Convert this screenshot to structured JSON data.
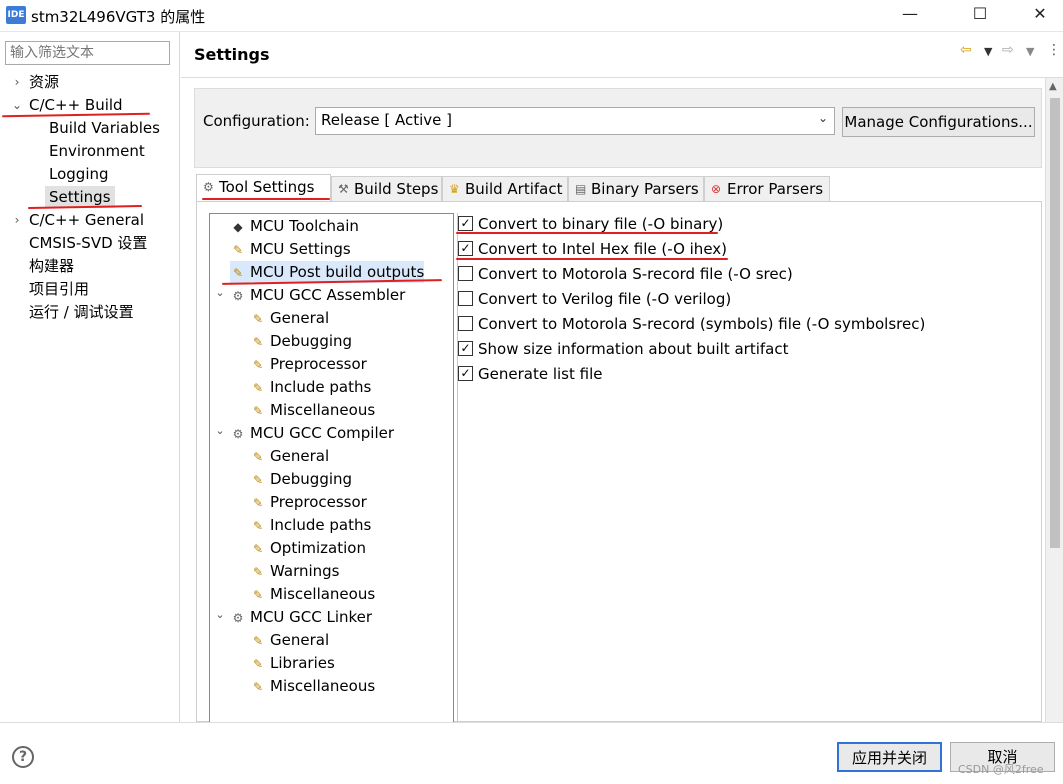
{
  "window": {
    "app_icon": "IDE",
    "title": "stm32L496VGT3 的属性",
    "minimize": "—",
    "maximize": "☐",
    "close": "✕"
  },
  "left": {
    "filter_placeholder": "输入筛选文本",
    "items": [
      {
        "label": "资源",
        "chevron": "›"
      },
      {
        "label": "C/C++ Build",
        "chevron": "⌄"
      },
      {
        "label": "Build Variables"
      },
      {
        "label": "Environment"
      },
      {
        "label": "Logging"
      },
      {
        "label": "Settings"
      },
      {
        "label": "C/C++ General",
        "chevron": "›"
      },
      {
        "label": "CMSIS-SVD 设置"
      },
      {
        "label": "构建器"
      },
      {
        "label": "项目引用"
      },
      {
        "label": "运行 / 调试设置"
      }
    ]
  },
  "header": {
    "title": "Settings",
    "icons": [
      "back-arrow",
      "dropdown",
      "forward-arrow",
      "dropdown",
      "menu"
    ]
  },
  "config": {
    "label": "Configuration:",
    "value": "Release  [ Active ]",
    "manage_button": "Manage Configurations..."
  },
  "tabs": [
    {
      "label": "Tool Settings",
      "icon": "gear"
    },
    {
      "label": "Build Steps",
      "icon": "hammer"
    },
    {
      "label": "Build Artifact",
      "icon": "trophy"
    },
    {
      "label": "Binary Parsers",
      "icon": "document"
    },
    {
      "label": "Error Parsers",
      "icon": "error"
    }
  ],
  "tree": [
    {
      "label": "MCU Toolchain"
    },
    {
      "label": "MCU Settings"
    },
    {
      "label": "MCU Post build outputs"
    },
    {
      "label": "MCU GCC Assembler"
    },
    {
      "label": "General"
    },
    {
      "label": "Debugging"
    },
    {
      "label": "Preprocessor"
    },
    {
      "label": "Include paths"
    },
    {
      "label": "Miscellaneous"
    },
    {
      "label": "MCU GCC Compiler"
    },
    {
      "label": "General"
    },
    {
      "label": "Debugging"
    },
    {
      "label": "Preprocessor"
    },
    {
      "label": "Include paths"
    },
    {
      "label": "Optimization"
    },
    {
      "label": "Warnings"
    },
    {
      "label": "Miscellaneous"
    },
    {
      "label": "MCU GCC Linker"
    },
    {
      "label": "General"
    },
    {
      "label": "Libraries"
    },
    {
      "label": "Miscellaneous"
    }
  ],
  "options": [
    {
      "label": "Convert to binary file (-O binary)",
      "checked": true
    },
    {
      "label": "Convert to Intel Hex file (-O ihex)",
      "checked": true
    },
    {
      "label": "Convert to Motorola S-record file (-O srec)",
      "checked": false
    },
    {
      "label": "Convert to Verilog file (-O verilog)",
      "checked": false
    },
    {
      "label": "Convert to Motorola S-record (symbols) file (-O symbolsrec)",
      "checked": false
    },
    {
      "label": "Show size information about built artifact",
      "checked": true
    },
    {
      "label": "Generate list file",
      "checked": true
    }
  ],
  "bottom": {
    "help": "?",
    "apply_close": "应用并关闭",
    "cancel": "取消",
    "watermark": "CSDN @风2free"
  },
  "colors": {
    "annotation": "#e02020",
    "selection": "#d9e8fb",
    "primary_border": "#2f73d8"
  }
}
